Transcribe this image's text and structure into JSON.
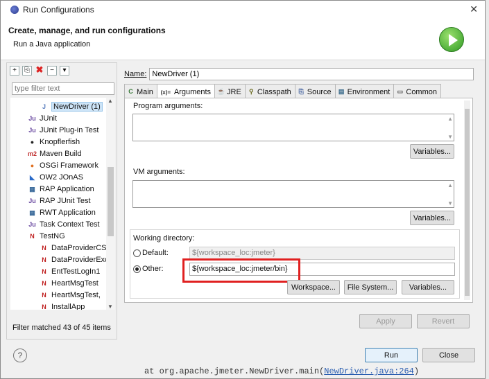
{
  "window": {
    "title": "Run Configurations",
    "close_glyph": "✕",
    "header_title": "Create, manage, and run configurations",
    "header_subtitle": "Run a Java application"
  },
  "left": {
    "filter_placeholder": "type filter text",
    "items": [
      {
        "label": "NewDriver (1)",
        "icon": "java-app-icon",
        "glyph": "J",
        "selected": true
      },
      {
        "label": "JUnit",
        "icon": "junit-icon",
        "glyph": "Ju"
      },
      {
        "label": "JUnit Plug-in Test",
        "icon": "junit-plugin-icon",
        "glyph": "Ju"
      },
      {
        "label": "Knopflerfish",
        "icon": "knopflerfish-icon",
        "glyph": "●"
      },
      {
        "label": "Maven Build",
        "icon": "maven-icon",
        "glyph": "m2"
      },
      {
        "label": "OSGi Framework",
        "icon": "osgi-icon",
        "glyph": "●"
      },
      {
        "label": "OW2 JOnAS",
        "icon": "jonas-icon",
        "glyph": "◣"
      },
      {
        "label": "RAP Application",
        "icon": "rap-icon",
        "glyph": "▦"
      },
      {
        "label": "RAP JUnit Test",
        "icon": "rap-junit-icon",
        "glyph": "Ju"
      },
      {
        "label": "RWT Application",
        "icon": "rwt-icon",
        "glyph": "▦"
      },
      {
        "label": "Task Context Test",
        "icon": "task-context-icon",
        "glyph": "Ju"
      },
      {
        "label": "TestNG",
        "icon": "testng-icon",
        "glyph": "N"
      },
      {
        "label": "DataProviderCSV",
        "icon": "testng-icon",
        "glyph": "N"
      },
      {
        "label": "DataProviderExce",
        "icon": "testng-icon",
        "glyph": "N"
      },
      {
        "label": "EntTestLogIn1",
        "icon": "testng-icon",
        "glyph": "N"
      },
      {
        "label": "HeartMsgTest",
        "icon": "testng-icon",
        "glyph": "N"
      },
      {
        "label": "HeartMsgTest,",
        "icon": "testng-icon",
        "glyph": "N"
      },
      {
        "label": "InstallApp",
        "icon": "testng-icon",
        "glyph": "N"
      }
    ],
    "status": "Filter matched 43 of 45 items"
  },
  "config": {
    "name_label": "Name:",
    "name_value": "NewDriver (1)",
    "tabs": [
      {
        "label": "Main",
        "icon": "main-tab-icon",
        "glyph": "C"
      },
      {
        "label": "Arguments",
        "icon": "arguments-tab-icon",
        "glyph": "(x)="
      },
      {
        "label": "JRE",
        "icon": "jre-tab-icon",
        "glyph": "☕"
      },
      {
        "label": "Classpath",
        "icon": "classpath-tab-icon",
        "glyph": "⚲"
      },
      {
        "label": "Source",
        "icon": "source-tab-icon",
        "glyph": "⎘"
      },
      {
        "label": "Environment",
        "icon": "environment-tab-icon",
        "glyph": "▤"
      },
      {
        "label": "Common",
        "icon": "common-tab-icon",
        "glyph": "▭"
      }
    ],
    "program_args_label": "Program arguments:",
    "variables_label": "Variables...",
    "vm_args_label": "VM arguments:",
    "working_dir_label": "Working directory:",
    "default_label": "Default:",
    "default_value": "${workspace_loc:jmeter}",
    "other_label": "Other:",
    "other_value": "${workspace_loc:jmeter/bin}",
    "workspace_btn": "Workspace...",
    "filesystem_btn": "File System...",
    "apply_btn": "Apply",
    "revert_btn": "Revert"
  },
  "footer": {
    "help_glyph": "?",
    "run_btn": "Run",
    "close_btn": "Close"
  },
  "background": {
    "code_prefix": "at org.apache.jmeter.NewDriver.main(",
    "code_link": "NewDriver.java:264",
    "code_suffix": ")"
  }
}
